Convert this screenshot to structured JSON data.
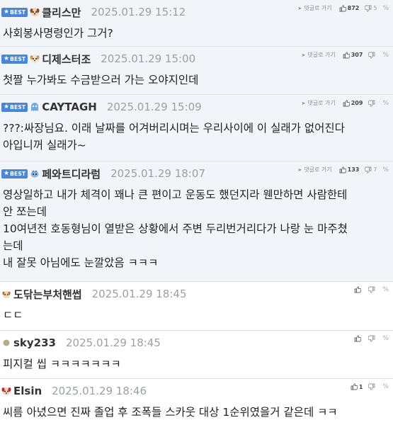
{
  "comments": [
    {
      "best": true,
      "nick": "클리스만",
      "date": "2025.01.29 15:12",
      "avatar": "puppy-icon",
      "reply_label": "댓글로 가기",
      "up": "872",
      "down": "5",
      "lines": [
        "사회봉사명령인가 그거?"
      ]
    },
    {
      "best": true,
      "nick": "디제스터조",
      "date": "2025.01.29 15:00",
      "avatar": "puppy-icon",
      "reply_label": "댓글로 가기",
      "up": "307",
      "down": "",
      "lines": [
        "첫짤 누가봐도 수금받으러 가는 오야지인데"
      ]
    },
    {
      "best": true,
      "nick": "CAYTAGH",
      "date": "2025.01.29 15:09",
      "avatar": "ghost-icon",
      "reply_label": "댓글로 가기",
      "up": "209",
      "down": "",
      "lines": [
        "???:싸장님요. 이래 날짜를 어겨버리시며는 우리사이에 이 실래가 없어진다",
        "아입니꺼 실래가~"
      ]
    },
    {
      "best": true,
      "nick": "페와트디라럼",
      "date": "2025.01.29 18:07",
      "avatar": "bird-icon",
      "reply_label": "댓글로 가기",
      "up": "133",
      "down": "7",
      "lines": [
        "영상일하고 내가 체격이 꽤나 큰 편이고 운동도 했던지라 웬만하면 사람한테",
        "안 쪼는데",
        "10여년전 호동형님이 열받은 상황에서 주변 두리번거리다가 나랑 눈 마주쳤",
        "는데",
        "내 잘못 아님에도 눈깔았음 ㅋㅋㅋ"
      ]
    },
    {
      "best": false,
      "nick": "도닦는부처핸썹",
      "date": "2025.01.29 18:45",
      "avatar": "puppy-small-icon",
      "reply_label": "",
      "up": "",
      "down": "",
      "lines": [
        "ㄷㄷ"
      ]
    },
    {
      "best": false,
      "nick": "sky233",
      "date": "2025.01.29 18:45",
      "avatar": "dot-icon",
      "reply_label": "",
      "up": "",
      "down": "",
      "lines": [
        "피지컬 씹 ㅋㅋㅋㅋㅋㅋㅋ"
      ]
    },
    {
      "best": false,
      "nick": "Elsin",
      "date": "2025.01.29 18:46",
      "avatar": "puppy-red-icon",
      "reply_label": "",
      "up": "1",
      "down": "",
      "lines": [
        "씨름 아녔으면 진짜 졸업 후 조폭들 스카웃 대상 1순위였을거 같은데 ㅋㅋ"
      ]
    }
  ],
  "best_label": "BEST",
  "colors": {
    "best_bg": "#f1f4f8",
    "badge": "#4a86d8",
    "date": "#9aa0a6",
    "border": "#dfe3e8"
  }
}
